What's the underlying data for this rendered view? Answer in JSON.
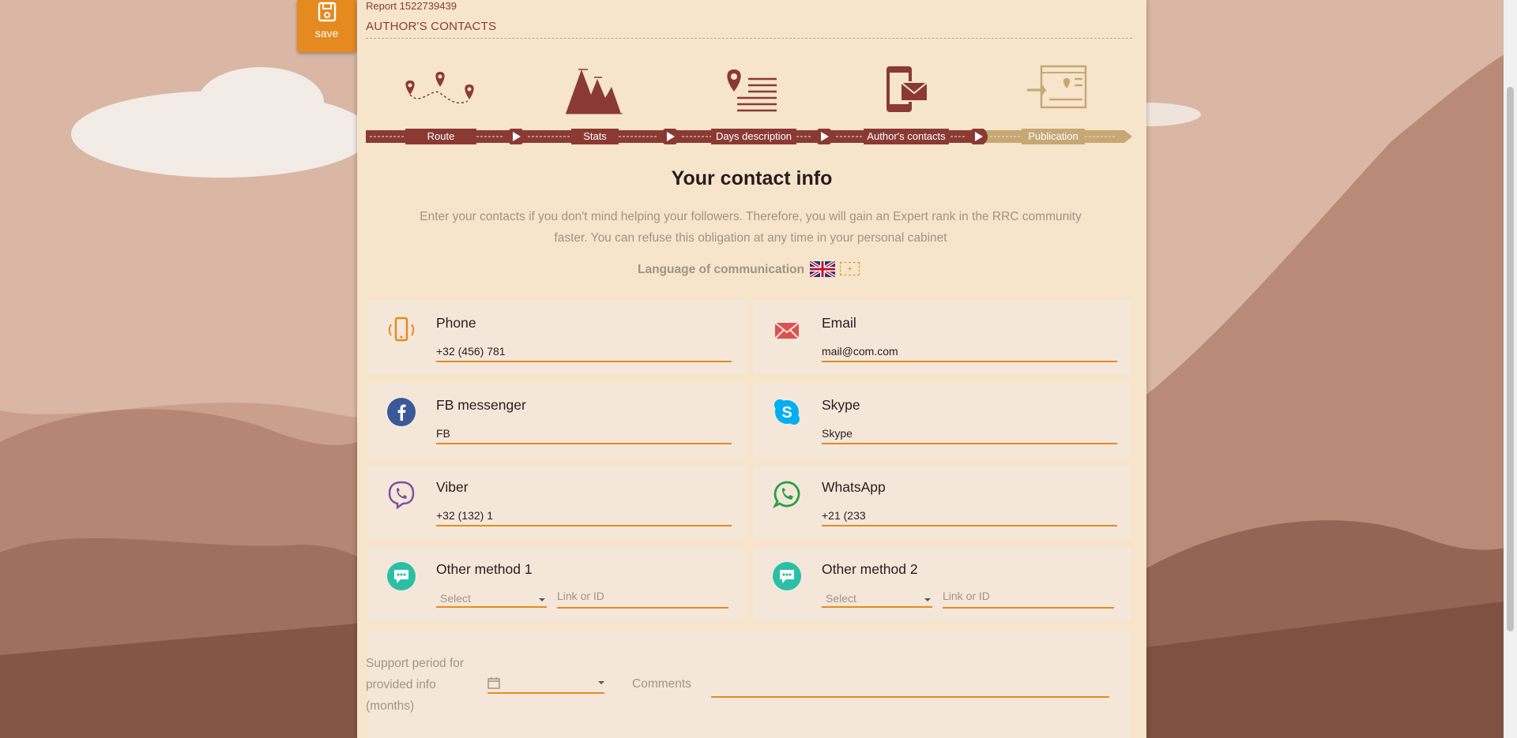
{
  "toolbar": {
    "save_label": "save"
  },
  "report": {
    "id_text": "Report 1522739439",
    "section": "AUTHOR'S CONTACTS"
  },
  "steps": [
    {
      "label": "Route",
      "icon": "route-map-icon",
      "done": true
    },
    {
      "label": "Stats",
      "icon": "mountain-stats-icon",
      "done": true
    },
    {
      "label": "Days description",
      "icon": "pin-list-icon",
      "done": true
    },
    {
      "label": "Author's contacts",
      "icon": "phone-mail-icon",
      "done": true
    },
    {
      "label": "Publication",
      "icon": "web-publish-icon",
      "done": false
    }
  ],
  "heading": {
    "title": "Your contact info",
    "description": "Enter your contacts if you don't mind helping your followers. Therefore, you will gain an Expert rank in the RRC community faster. You can refuse this obligation at any time in your personal cabinet"
  },
  "language": {
    "label": "Language of communication",
    "add": "+"
  },
  "contacts": {
    "phone": {
      "label": "Phone",
      "value": "+32 (456) 781"
    },
    "email": {
      "label": "Email",
      "value": "mail@com.com"
    },
    "fb": {
      "label": "FB messenger",
      "value": "FB"
    },
    "skype": {
      "label": "Skype",
      "value": "Skype"
    },
    "viber": {
      "label": "Viber",
      "value": "+32 (132) 1"
    },
    "whatsapp": {
      "label": "WhatsApp",
      "value": "+21 (233"
    },
    "other1": {
      "label": "Other method 1",
      "select": "Select",
      "placeholder": "Link or ID"
    },
    "other2": {
      "label": "Other method 2",
      "select": "Select",
      "placeholder": "Link or ID"
    }
  },
  "support": {
    "label": "Support period for provided info (months)",
    "comments": "Comments"
  },
  "colors": {
    "accent": "#e58a1f",
    "brand": "#8a3a33",
    "panel": "#f6e5cb"
  }
}
